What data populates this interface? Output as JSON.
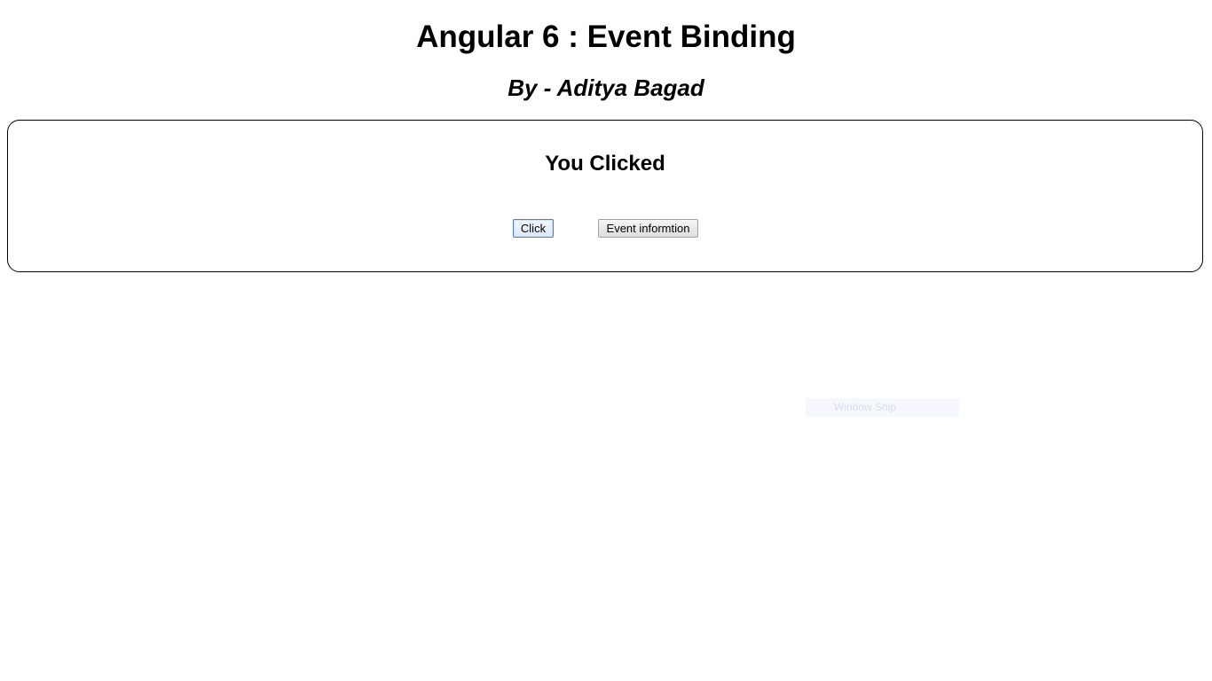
{
  "header": {
    "title": "Angular 6 : Event Binding",
    "author": "By - Aditya Bagad"
  },
  "panel": {
    "message": "You Clicked",
    "buttons": {
      "click_label": "Click",
      "event_info_label": "Event informtion"
    }
  },
  "overlay": {
    "snip_label": "Window Snip"
  }
}
